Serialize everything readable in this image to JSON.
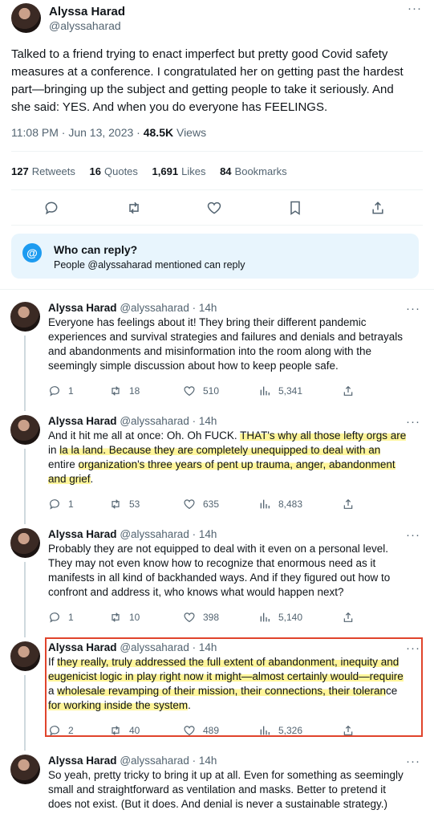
{
  "main_tweet": {
    "name": "Alyssa Harad",
    "handle": "@alyssaharad",
    "text_lines": [
      "Talked to a friend trying to enact imperfect but pretty good Covid safety",
      "measures at a conference. I congratulated her on getting past the hardest",
      "part—bringing up the subject and getting people to take it seriously. And",
      "she said: YES. And when you do everyone has FEELINGS."
    ],
    "time": "11:08 PM · Jun 13, 2023 · ",
    "views_count": "48.5K",
    "views_label": " Views",
    "stats": {
      "retweets_count": "127",
      "retweets_label": "Retweets",
      "quotes_count": "16",
      "quotes_label": "Quotes",
      "likes_count": "1,691",
      "likes_label": "Likes",
      "bookmarks_count": "84",
      "bookmarks_label": "Bookmarks"
    },
    "actions": [
      "reply-icon",
      "retweet-icon",
      "like-icon",
      "bookmark-icon",
      "share-icon"
    ]
  },
  "who_can_reply": {
    "icon": "@",
    "title": "Who can reply?",
    "subtitle": "People @alyssaharad mentioned can reply"
  },
  "replies": [
    {
      "name": "Alyssa Harad",
      "handle_time": "@alyssaharad · 14h",
      "text_lines": [
        "Everyone has feelings about it! They bring their different pandemic",
        "experiences and survival strategies and failures and denials and betrayals",
        "and abandonments and misinformation into the room along with the",
        "seemingly simple discussion about how to keep people safe."
      ],
      "replies": "1",
      "retweets": "18",
      "likes": "510",
      "views": "5,341"
    },
    {
      "name": "Alyssa Harad",
      "handle_time": "@alyssaharad · 14h",
      "text_plain_1": "And it hit me all at once: Oh. Oh FUCK. ",
      "text_hl_1": "THAT's why all those lefty orgs are",
      "text_plain_2": "in ",
      "text_hl_2": "la la land. Because they are completely unequipped to deal with an",
      "text_plain_3": "entire ",
      "text_hl_3": "organization's three years of pent up trauma, anger, abandonment",
      "text_hl_4": "and grief",
      "text_plain_4": ".",
      "replies": "1",
      "retweets": "53",
      "likes": "635",
      "views": "8,483"
    },
    {
      "name": "Alyssa Harad",
      "handle_time": "@alyssaharad · 14h",
      "text_lines": [
        "Probably they are not equipped to deal with it even on a personal level.",
        "They may not even know how to recognize that enormous need as it",
        "manifests in all kind of backhanded ways. And if they figured out how to",
        "confront and address it, who knows what would happen next?"
      ],
      "replies": "1",
      "retweets": "10",
      "likes": "398",
      "views": "5,140"
    },
    {
      "name": "Alyssa Harad",
      "handle_time": "@alyssaharad · 14h",
      "text_plain_1": "If ",
      "text_hl_1": "they really, truly addressed the full extent of abandonment, inequity and",
      "text_hl_2": "eugenicist logic in play right now it might—almost certainly would—require",
      "text_plain_2": "a ",
      "text_hl_3": "wholesale revamping of their mission, their connections, their toleran",
      "text_plain_3": "ce",
      "text_hl_4": "for working inside the system",
      "text_plain_4": ".",
      "replies": "2",
      "retweets": "40",
      "likes": "489",
      "views": "5,326"
    },
    {
      "name": "Alyssa Harad",
      "handle_time": "@alyssaharad · 14h",
      "text_lines": [
        "So yeah, pretty tricky to bring it up at all. Even for something as seemingly",
        "small and straightforward as ventilation and masks. Better to pretend it",
        "does not exist. (But it does. And denial is never a sustainable strategy.)"
      ]
    }
  ],
  "colors": {
    "accent": "#1d9bf0",
    "highlight": "#fff59a",
    "box_border": "#e0442c"
  }
}
